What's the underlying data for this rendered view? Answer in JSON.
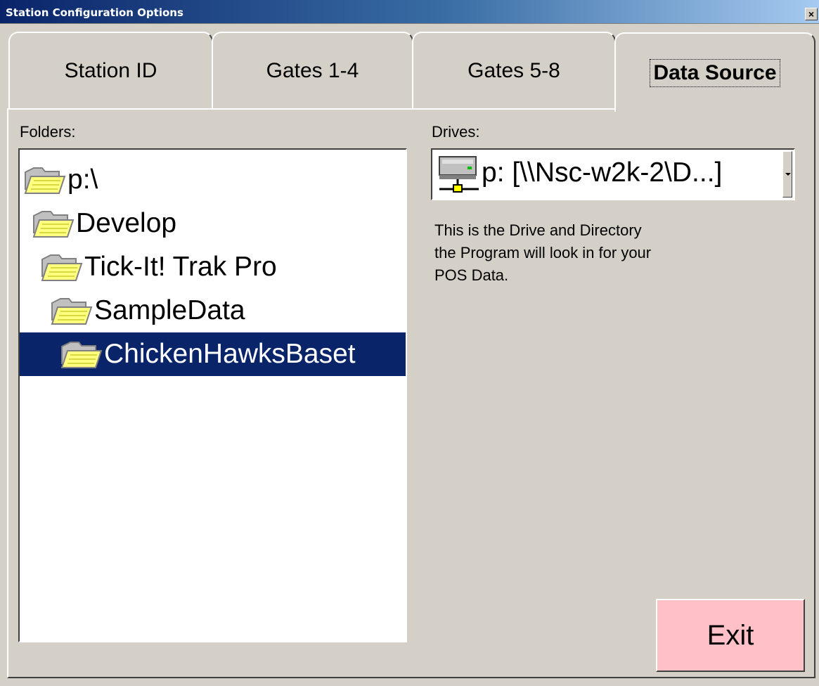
{
  "window": {
    "title": "Station Configuration Options",
    "close_label": "×"
  },
  "tabs": [
    {
      "label": "Station ID",
      "active": false
    },
    {
      "label": "Gates 1-4",
      "active": false
    },
    {
      "label": "Gates 5-8",
      "active": false
    },
    {
      "label": "Data Source",
      "active": true
    }
  ],
  "folders": {
    "label": "Folders:",
    "items": [
      {
        "name": "p:\\",
        "icon": "folder-open-icon"
      },
      {
        "name": "Develop",
        "icon": "folder-open-icon"
      },
      {
        "name": "Tick-It! Trak Pro",
        "icon": "folder-open-icon"
      },
      {
        "name": "SampleData",
        "icon": "folder-open-icon"
      },
      {
        "name": "ChickenHawksBaset",
        "icon": "folder-open-icon",
        "selected": true
      }
    ]
  },
  "drives": {
    "label": "Drives:",
    "selected": "p: [\\\\Nsc-w2k-2\\D...]",
    "icon": "network-drive-icon"
  },
  "help_text": {
    "line1": "This is the Drive and Directory",
    "line2": "the Program will look in for your",
    "line3": "POS Data."
  },
  "exit_button": {
    "label": "Exit"
  },
  "colors": {
    "selection": "#0a246a",
    "exit_bg": "#ffc0c8",
    "face": "#d4d0c8"
  }
}
